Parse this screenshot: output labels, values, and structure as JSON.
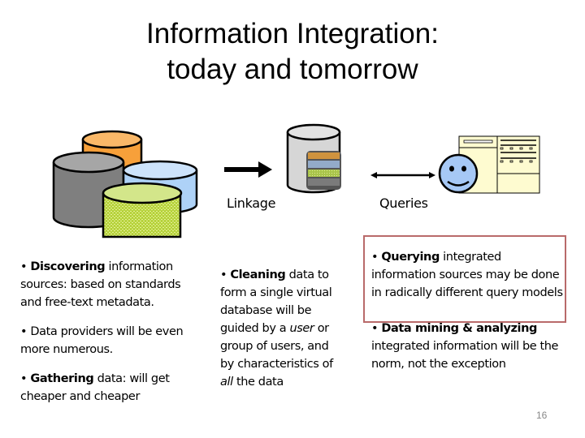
{
  "slide": {
    "title_line1": "Information Integration:",
    "title_line2": "today and tomorrow",
    "page_number": "16"
  },
  "diagram": {
    "linkage_label": "Linkage",
    "queries_label": "Queries",
    "colors": {
      "orange_db": "#f7a03a",
      "gray_db": "#7f7f7f",
      "blue_db": "#aed2f7",
      "green_db": "#c2dc4a",
      "central_db": "#d6d6d6",
      "smiley": "#a6c8f5",
      "window": "#fefbd0",
      "highlight_border": "#b96a6a"
    }
  },
  "columns": [
    {
      "bullets": [
        {
          "bold": "Discovering",
          "rest": " information sources:  based on standards and free-text metadata."
        },
        {
          "bold": "",
          "rest": "Data providers will be even more numerous."
        },
        {
          "bold": "Gathering",
          "rest": " data: will get cheaper and cheaper"
        }
      ]
    },
    {
      "bullets": [
        {
          "bold": "Cleaning",
          "rest_a": " data to form a single virtual database will be guided by a ",
          "italic_a": "user",
          "rest_b": " or group of users, and by characteristics of ",
          "italic_b": "all",
          "rest_c": " the data"
        }
      ]
    },
    {
      "bullets": [
        {
          "bold": "Querying",
          "rest": " integrated information sources may be done in radically different query models"
        },
        {
          "bold": "Data mining & analyzing",
          "rest": " integrated information will be the norm, not the exception"
        }
      ]
    }
  ]
}
